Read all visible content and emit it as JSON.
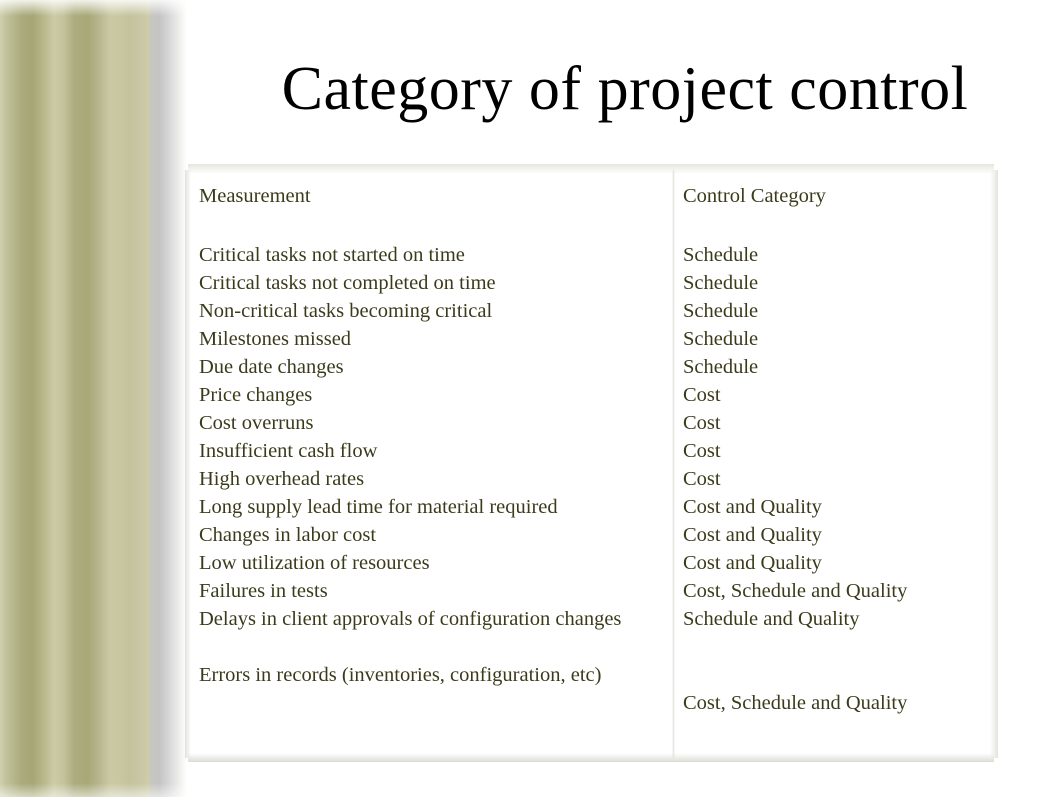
{
  "slide": {
    "title": "Category of project control",
    "accent_band_color": "#a8a878",
    "text_color": "#3b3b1b",
    "background_color": "#ffffff"
  },
  "table": {
    "headers": {
      "measurement": "Measurement",
      "control_category": "Control Category"
    },
    "rows": [
      {
        "measurement": "Critical tasks not started on time",
        "category": "Schedule"
      },
      {
        "measurement": "Critical tasks not completed on time",
        "category": "Schedule"
      },
      {
        "measurement": "Non-critical tasks becoming critical",
        "category": "Schedule"
      },
      {
        "measurement": "Milestones missed",
        "category": "Schedule"
      },
      {
        "measurement": "Due date changes",
        "category": "Schedule"
      },
      {
        "measurement": "Price changes",
        "category": "Cost"
      },
      {
        "measurement": "Cost overruns",
        "category": "Cost"
      },
      {
        "measurement": "Insufficient cash flow",
        "category": "Cost"
      },
      {
        "measurement": "High overhead rates",
        "category": "Cost"
      },
      {
        "measurement": "Long supply lead time for material required",
        "category": "Cost and Quality"
      },
      {
        "measurement": "Changes in labor cost",
        "category": "Cost and Quality"
      },
      {
        "measurement": "Low utilization of resources",
        "category": "Cost and Quality"
      },
      {
        "measurement": "Failures in tests",
        "category": "Cost, Schedule and Quality"
      },
      {
        "measurement": "Delays in client approvals of configuration changes",
        "category": "Schedule and Quality"
      },
      {
        "measurement": "Errors in records (inventories, configuration, etc)",
        "category": "Cost, Schedule and Quality"
      }
    ]
  }
}
